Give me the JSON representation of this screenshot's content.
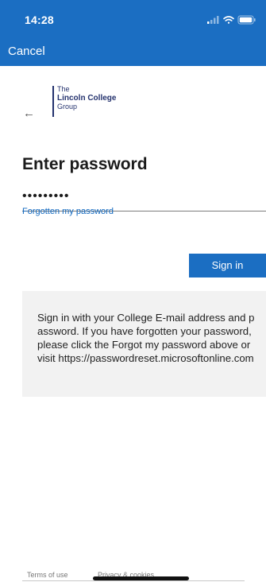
{
  "status_bar": {
    "time": "14:28",
    "icons": [
      "cellular-signal-icon",
      "wifi-icon",
      "battery-icon"
    ]
  },
  "header": {
    "cancel_label": "Cancel"
  },
  "logo": {
    "line1": "The",
    "line2": "Lincoln College",
    "line3": "Group"
  },
  "back_icon": "back-arrow-icon",
  "title": "Enter password",
  "password_field": {
    "value": "•••••••••"
  },
  "forgot_label": "Forgotten my password",
  "signin_label": "Sign in",
  "info_text": "Sign in with your College E-mail address and password. If you have forgotten your password, please click the Forgot my password above or visit https://passwordreset.microsoftonline.com",
  "footer": {
    "terms_label": "Terms of use",
    "privacy_label": "Privacy & cookies"
  },
  "colors": {
    "brand_blue": "#1b6ec2",
    "link_blue": "#0f67bf",
    "logo_navy": "#24326e",
    "info_bg": "#f2f2f2"
  }
}
